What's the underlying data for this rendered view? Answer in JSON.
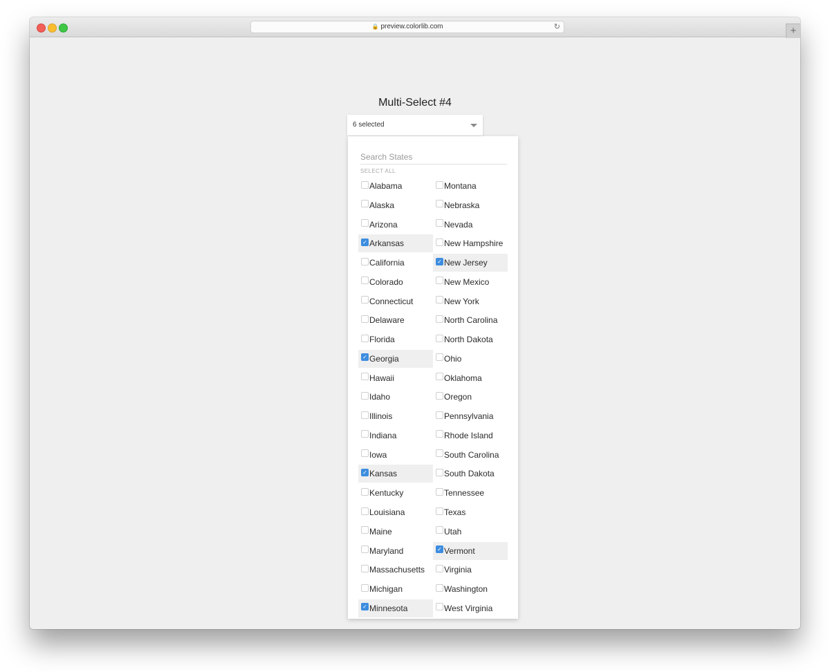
{
  "browser": {
    "url": "preview.colorlib.com",
    "new_tab_label": "+"
  },
  "page": {
    "title": "Multi-Select #4",
    "select": {
      "value": "6 selected"
    },
    "dropdown": {
      "search_placeholder": "Search States",
      "select_all_label": "SELECT ALL",
      "columns": [
        [
          {
            "label": "Alabama",
            "checked": false
          },
          {
            "label": "Alaska",
            "checked": false
          },
          {
            "label": "Arizona",
            "checked": false
          },
          {
            "label": "Arkansas",
            "checked": true
          },
          {
            "label": "California",
            "checked": false
          },
          {
            "label": "Colorado",
            "checked": false
          },
          {
            "label": "Connecticut",
            "checked": false
          },
          {
            "label": "Delaware",
            "checked": false
          },
          {
            "label": "Florida",
            "checked": false
          },
          {
            "label": "Georgia",
            "checked": true
          },
          {
            "label": "Hawaii",
            "checked": false
          },
          {
            "label": "Idaho",
            "checked": false
          },
          {
            "label": "Illinois",
            "checked": false
          },
          {
            "label": "Indiana",
            "checked": false
          },
          {
            "label": "Iowa",
            "checked": false
          },
          {
            "label": "Kansas",
            "checked": true
          },
          {
            "label": "Kentucky",
            "checked": false
          },
          {
            "label": "Louisiana",
            "checked": false
          },
          {
            "label": "Maine",
            "checked": false
          },
          {
            "label": "Maryland",
            "checked": false
          },
          {
            "label": "Massachusetts",
            "checked": false
          },
          {
            "label": "Michigan",
            "checked": false
          },
          {
            "label": "Minnesota",
            "checked": true
          }
        ],
        [
          {
            "label": "Montana",
            "checked": false
          },
          {
            "label": "Nebraska",
            "checked": false
          },
          {
            "label": "Nevada",
            "checked": false
          },
          {
            "label": "New Hampshire",
            "checked": false
          },
          {
            "label": "New Jersey",
            "checked": true
          },
          {
            "label": "New Mexico",
            "checked": false
          },
          {
            "label": "New York",
            "checked": false
          },
          {
            "label": "North Carolina",
            "checked": false
          },
          {
            "label": "North Dakota",
            "checked": false
          },
          {
            "label": "Ohio",
            "checked": false
          },
          {
            "label": "Oklahoma",
            "checked": false
          },
          {
            "label": "Oregon",
            "checked": false
          },
          {
            "label": "Pennsylvania",
            "checked": false
          },
          {
            "label": "Rhode Island",
            "checked": false
          },
          {
            "label": "South Carolina",
            "checked": false
          },
          {
            "label": "South Dakota",
            "checked": false
          },
          {
            "label": "Tennessee",
            "checked": false
          },
          {
            "label": "Texas",
            "checked": false
          },
          {
            "label": "Utah",
            "checked": false
          },
          {
            "label": "Vermont",
            "checked": true
          },
          {
            "label": "Virginia",
            "checked": false
          },
          {
            "label": "Washington",
            "checked": false
          },
          {
            "label": "West Virginia",
            "checked": false
          }
        ]
      ]
    }
  },
  "colors": {
    "accent": "#3d8ddf",
    "page_background": "#efefef",
    "selected_row": "#efefef"
  }
}
